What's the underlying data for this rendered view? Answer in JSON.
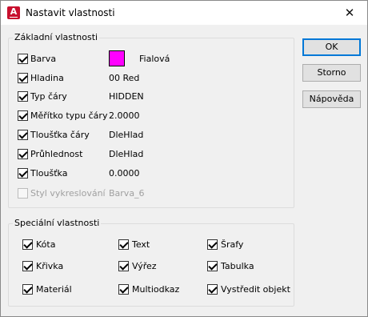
{
  "window": {
    "title": "Nastavit vlastnosti",
    "close_glyph": "✕",
    "app_icon_letter": "A"
  },
  "basic": {
    "legend": "Základní vlastnosti",
    "rows": [
      {
        "label": "Barva",
        "value": "Fialová",
        "checked": true,
        "enabled": true,
        "swatch": "#ff00ff"
      },
      {
        "label": "Hladina",
        "value": "00 Red",
        "checked": true,
        "enabled": true
      },
      {
        "label": "Typ čáry",
        "value": "HIDDEN",
        "checked": true,
        "enabled": true
      },
      {
        "label": "Měřítko typu čáry",
        "value": "2.0000",
        "checked": true,
        "enabled": true
      },
      {
        "label": "Tloušťka čáry",
        "value": "DleHlad",
        "checked": true,
        "enabled": true
      },
      {
        "label": "Průhlednost",
        "value": "DleHlad",
        "checked": true,
        "enabled": true
      },
      {
        "label": "Tloušťka",
        "value": "0.0000",
        "checked": true,
        "enabled": true
      },
      {
        "label": "Styl vykreslování",
        "value": "Barva_6",
        "checked": false,
        "enabled": false
      }
    ]
  },
  "special": {
    "legend": "Speciální vlastnosti",
    "items": [
      {
        "label": "Kóta",
        "checked": true
      },
      {
        "label": "Text",
        "checked": true
      },
      {
        "label": "Šrafy",
        "checked": true
      },
      {
        "label": "Křivka",
        "checked": true
      },
      {
        "label": "Výřez",
        "checked": true
      },
      {
        "label": "Tabulka",
        "checked": true
      },
      {
        "label": "Materiál",
        "checked": true
      },
      {
        "label": "Multiodkaz",
        "checked": true
      },
      {
        "label": "Vystředit objekt",
        "checked": true
      }
    ]
  },
  "buttons": {
    "ok": "OK",
    "cancel": "Storno",
    "help": "Nápověda"
  }
}
